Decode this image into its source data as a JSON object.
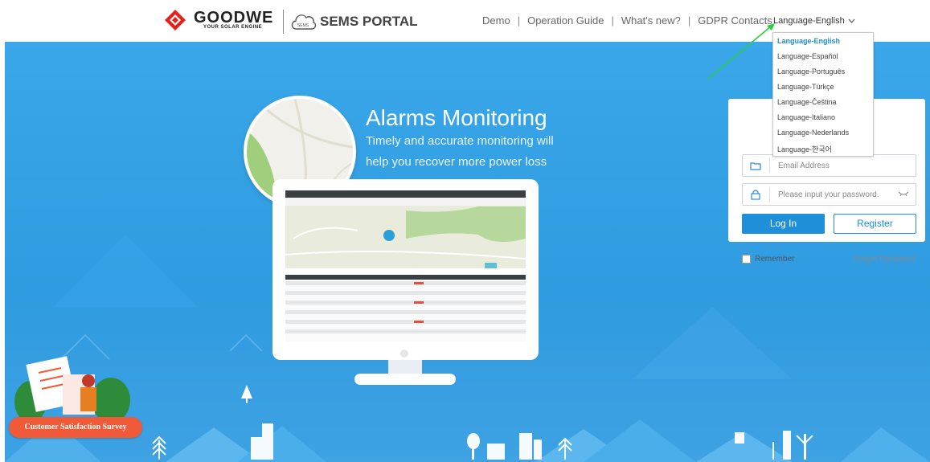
{
  "header": {
    "brand_name": "GOODWE",
    "brand_tagline": "YOUR SOLAR ENGINE",
    "portal_badge": "SEMS",
    "portal_name": "SEMS PORTAL",
    "nav": [
      {
        "label": "Demo"
      },
      {
        "label": "Operation Guide"
      },
      {
        "label": "What's new?"
      },
      {
        "label": "GDPR Contacts"
      }
    ],
    "nav_separator": "|",
    "language_current": "Language-English"
  },
  "language_menu": {
    "options": [
      {
        "label": "Language-English",
        "active": true
      },
      {
        "label": "Language-Español"
      },
      {
        "label": "Language-Português"
      },
      {
        "label": "Language-Türkçe"
      },
      {
        "label": "Language-Čeština"
      },
      {
        "label": "Language-Italiano"
      },
      {
        "label": "Language-Nederlands"
      },
      {
        "label": "Language-한국어"
      }
    ]
  },
  "hero": {
    "title": "Alarms Monitoring",
    "subtitle_line1": "Timely and accurate monitoring will",
    "subtitle_line2": "help you recover more power loss"
  },
  "login": {
    "email_placeholder": "Email Address",
    "password_placeholder": "Please input your password.",
    "login_button": "Log In",
    "register_button": "Register",
    "remember_label": "Remember",
    "forget_password": "Forget Password"
  },
  "survey": {
    "label": "Customer Satisfaction Survey"
  },
  "colors": {
    "hero_blue": "#2f9be0",
    "accent_blue": "#1e8fd8",
    "brand_red": "#e2231a",
    "survey_orange": "#f05a38",
    "arrow_green": "#2ecc40"
  },
  "icons": {
    "brand": "goodwe-diamond-icon",
    "portal": "cloud-icon",
    "dropdown": "chevron-down-icon",
    "email": "folder-icon",
    "password": "lock-icon",
    "show_password": "eye-icon"
  }
}
